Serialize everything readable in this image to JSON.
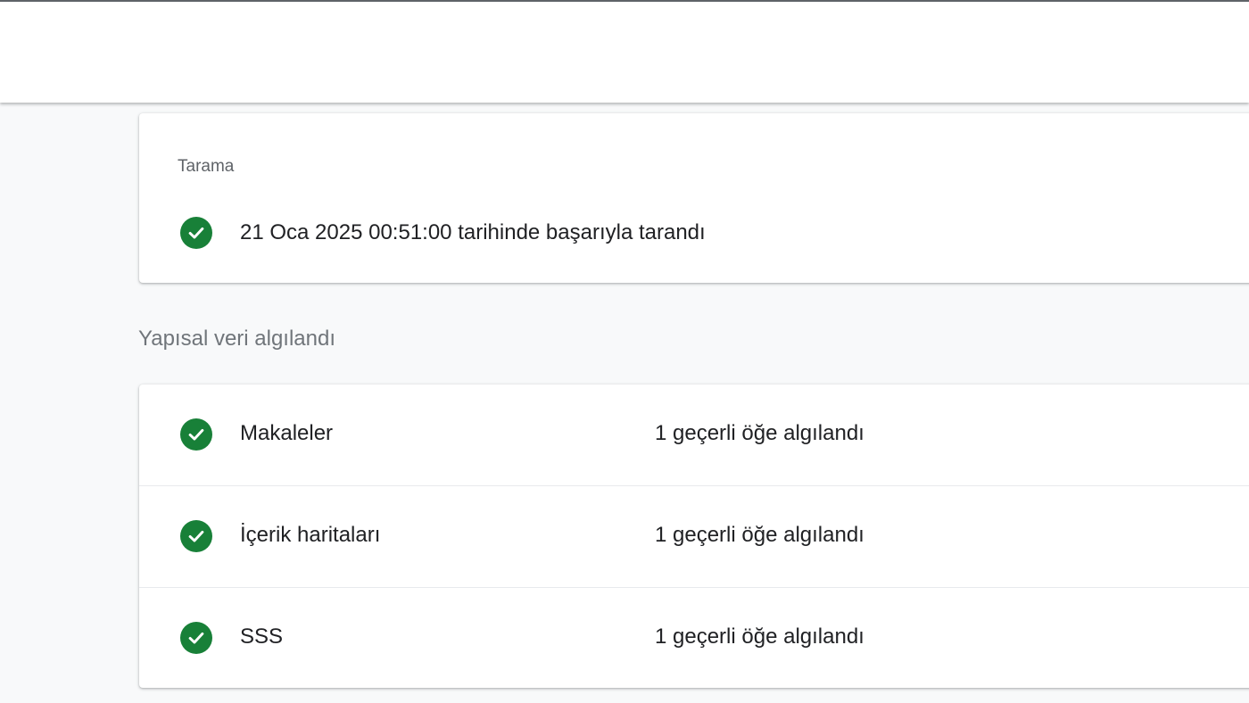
{
  "crawl": {
    "heading": "Tarama",
    "status_icon": "check-circle-icon",
    "status_text": "21 Oca 2025 00:51:00 tarihinde başarıyla tarandı"
  },
  "structured_data": {
    "title": "Yapısal veri algılandı",
    "items": [
      {
        "name": "Makaleler",
        "status": "1 geçerli öğe algılandı",
        "icon": "check-circle-icon"
      },
      {
        "name": "İçerik haritaları",
        "status": "1 geçerli öğe algılandı",
        "icon": "check-circle-icon"
      },
      {
        "name": "SSS",
        "status": "1 geçerli öğe algılandı",
        "icon": "check-circle-icon"
      }
    ]
  },
  "colors": {
    "success": "#188038",
    "background": "#f8f9fa",
    "card": "#ffffff",
    "secondary_text": "#5f6368"
  }
}
